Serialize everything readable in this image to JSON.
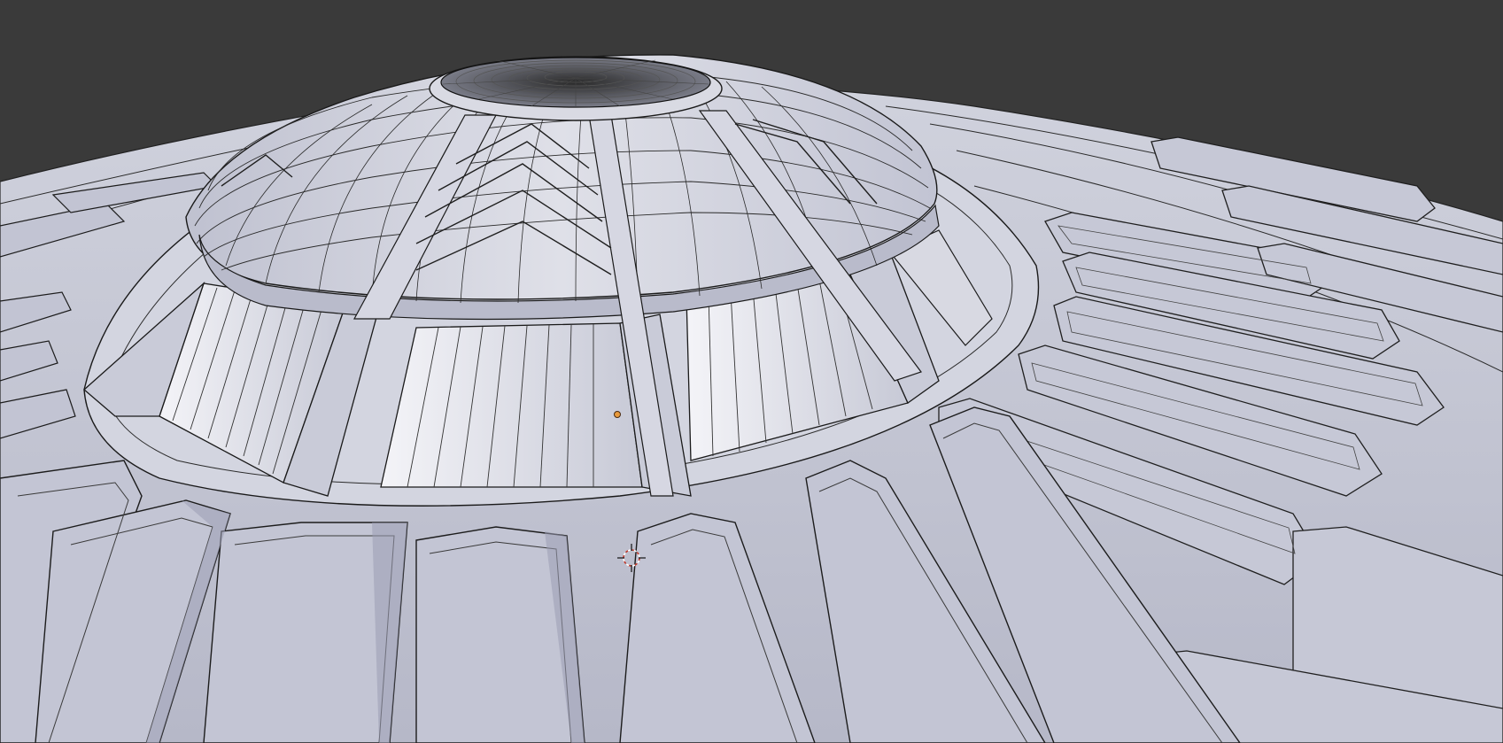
{
  "viewport": {
    "editor": "3D Viewport",
    "shading": "solid-wireframe",
    "background_color": "#3a3a3a",
    "mesh_color": "#c4c6d4",
    "mesh_shadow_color": "#9498ae",
    "wire_color": "#1a1a1a",
    "cursor_color": "#c0392b"
  },
  "scene": {
    "object": "spaceship-hull-dome",
    "description_icon": "3d-cursor-icon",
    "origin_icon": "object-origin-icon"
  }
}
